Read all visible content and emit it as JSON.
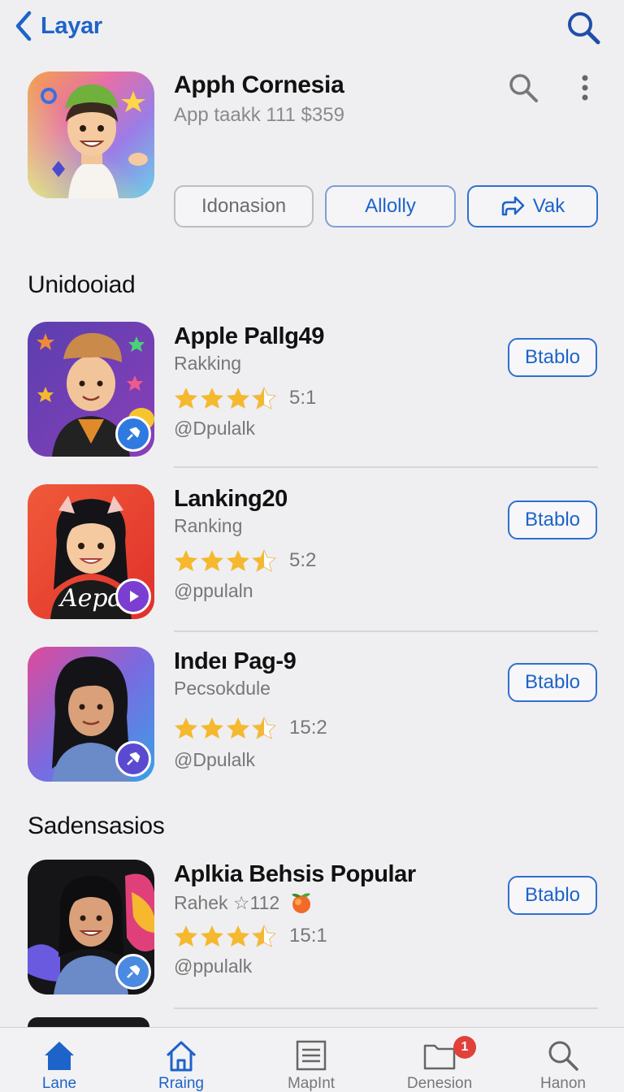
{
  "nav": {
    "back_label": "Layar"
  },
  "hero": {
    "title": "Apph Cornesia",
    "subtitle": "App taakk 111 $359",
    "buttons": [
      "Idonasion",
      "Allolly",
      "Vak"
    ]
  },
  "sections": [
    {
      "title": "Unidooiad",
      "apps": [
        {
          "name": "Apple Pallg49",
          "subtitle": "Rakking",
          "stars": 3.5,
          "rating_text": "5:1",
          "handle": "@Dpulalk",
          "button": "Btablo",
          "badge_icon": "pin-icon"
        },
        {
          "name": "Lanking20",
          "subtitle": "Ranking",
          "stars": 3.5,
          "rating_text": "5:2",
          "handle": "@ppulaln",
          "button": "Btablo",
          "badge_icon": "play-icon"
        },
        {
          "name": "Indeı Pag-9",
          "subtitle": "Pecsokdule",
          "stars": 3.5,
          "rating_text": "15:2",
          "handle": "@Dpulalk",
          "button": "Btablo",
          "badge_icon": "pin-icon"
        }
      ]
    },
    {
      "title": "Sadensasios",
      "apps": [
        {
          "name": "Aplkia Behsis Popular",
          "subtitle": "Rahek ☆112",
          "stars": 3.5,
          "rating_text": "15:1",
          "handle": "@ppulalk",
          "button": "Btablo",
          "badge_icon": "pin-icon"
        }
      ]
    }
  ],
  "tabs": [
    {
      "label": "Lane",
      "icon": "home-icon",
      "active": true
    },
    {
      "label": "Rraing",
      "icon": "house-outline-icon",
      "active": false
    },
    {
      "label": "MapInt",
      "icon": "list-icon",
      "active": false
    },
    {
      "label": "Denesion",
      "icon": "folder-icon",
      "active": false,
      "badge": "1"
    },
    {
      "label": "Hanon",
      "icon": "search-icon",
      "active": false
    }
  ],
  "colors": {
    "accent": "#1e63c9",
    "star": "#f5b82e",
    "badge": "#e0413a",
    "background": "#efeff1"
  }
}
